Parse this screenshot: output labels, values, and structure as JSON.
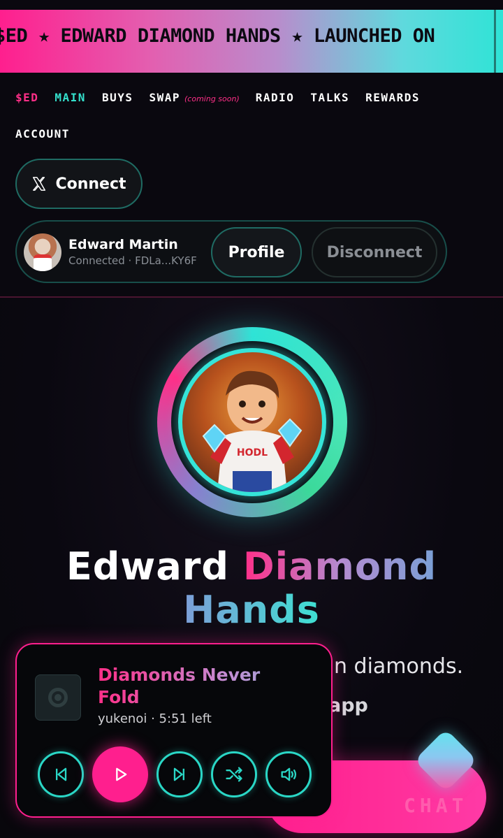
{
  "ticker": {
    "text": "$ED ★ EDWARD DIAMOND HANDS ★ LAUNCHED ON"
  },
  "nav": {
    "items": [
      {
        "label": "$ED"
      },
      {
        "label": "MAIN"
      },
      {
        "label": "BUYS"
      },
      {
        "label": "SWAP"
      },
      {
        "label": "RADIO"
      },
      {
        "label": "TALKS"
      },
      {
        "label": "REWARDS"
      },
      {
        "label": "ACCOUNT"
      }
    ],
    "swap_note": "(coming soon)",
    "active": "MAIN"
  },
  "connect": {
    "label": "Connect",
    "icon": "x-logo-icon"
  },
  "user": {
    "name": "Edward Martin",
    "status": "Connected · FDLa...KY6F",
    "profile_label": "Profile",
    "disconnect_label": "Disconnect"
  },
  "hero": {
    "title_word1": "Edward",
    "title_word2": "Diamond",
    "title_word3": "Hands",
    "subtitle_fragment": "n diamonds.",
    "subtitle_fragment2": "app"
  },
  "player": {
    "track_title": "Diamonds Never Fold",
    "artist": "yukenoi",
    "time_left": "5:51 left",
    "meta_separator": " · ",
    "controls": [
      "previous-icon",
      "play-icon",
      "next-icon",
      "shuffle-icon",
      "volume-icon"
    ]
  },
  "chat": {
    "label": "CHAT"
  },
  "colors": {
    "accent_pink": "#ff1f8e",
    "accent_teal": "#2fe3d6",
    "background": "#0a080f"
  }
}
